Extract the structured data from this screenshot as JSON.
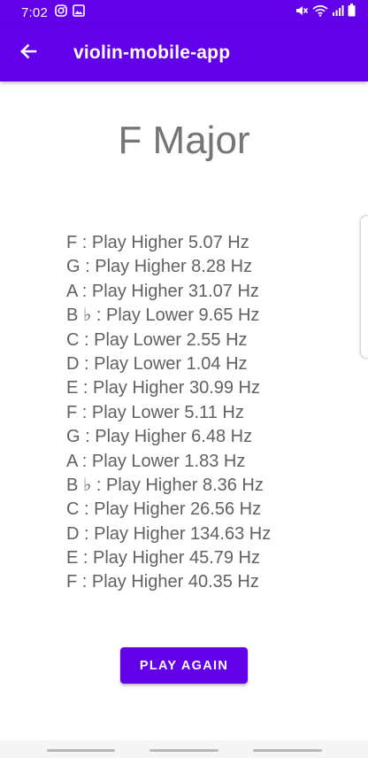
{
  "status_bar": {
    "time": "7:02",
    "left_icons": [
      "instagram-icon",
      "image-icon"
    ],
    "right_icons": [
      "mute-icon",
      "wifi-icon",
      "signal-icon",
      "battery-icon"
    ]
  },
  "app_bar": {
    "title": "violin-mobile-app",
    "back_icon": "arrow-left-icon"
  },
  "scale_title": "F Major",
  "notes": [
    "F : Play Higher 5.07 Hz",
    "G : Play Higher 8.28 Hz",
    "A : Play Higher 31.07 Hz",
    "B ♭ : Play Lower 9.65 Hz",
    "C : Play Lower 2.55 Hz",
    "D : Play Lower 1.04 Hz",
    "E : Play Higher 30.99 Hz",
    "F : Play Lower 5.11 Hz",
    "G : Play Higher 6.48 Hz",
    "A : Play Lower 1.83 Hz",
    "B ♭ : Play Higher 8.36 Hz",
    "C : Play Higher 26.56 Hz",
    "D : Play Higher 134.63 Hz",
    "E : Play Higher 45.79 Hz",
    "F : Play Higher 40.35 Hz"
  ],
  "play_again_label": "PLAY AGAIN",
  "colors": {
    "primary": "#6200ea",
    "title_text": "#757575",
    "body_text": "#616161"
  }
}
